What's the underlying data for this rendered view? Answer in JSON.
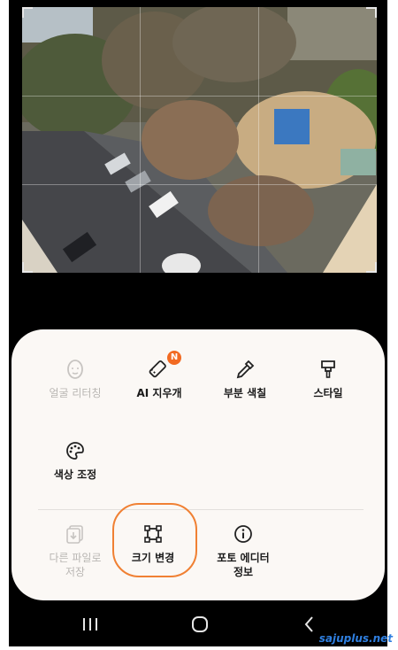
{
  "editor": {
    "tools": [
      {
        "label": "얼굴 리터칭",
        "enabled": false,
        "icon": "face-icon"
      },
      {
        "label": "AI 지우개",
        "enabled": true,
        "icon": "eraser-icon",
        "badge": "N"
      },
      {
        "label": "부분 색칠",
        "enabled": true,
        "icon": "dropper-icon"
      },
      {
        "label": "스타일",
        "enabled": true,
        "icon": "brush-icon"
      },
      {
        "label": "색상 조정",
        "enabled": true,
        "icon": "palette-icon"
      },
      {
        "label": "다른 파일로\n저장",
        "enabled": false,
        "icon": "save-file-icon"
      },
      {
        "label": "크기 변경",
        "enabled": true,
        "icon": "resize-icon",
        "highlighted": true
      },
      {
        "label": "포토 에디터\n정보",
        "enabled": true,
        "icon": "info-icon"
      }
    ]
  },
  "highlight_color": "#f08033",
  "badge_color": "#f26a22",
  "watermark": "sajuplus.net"
}
